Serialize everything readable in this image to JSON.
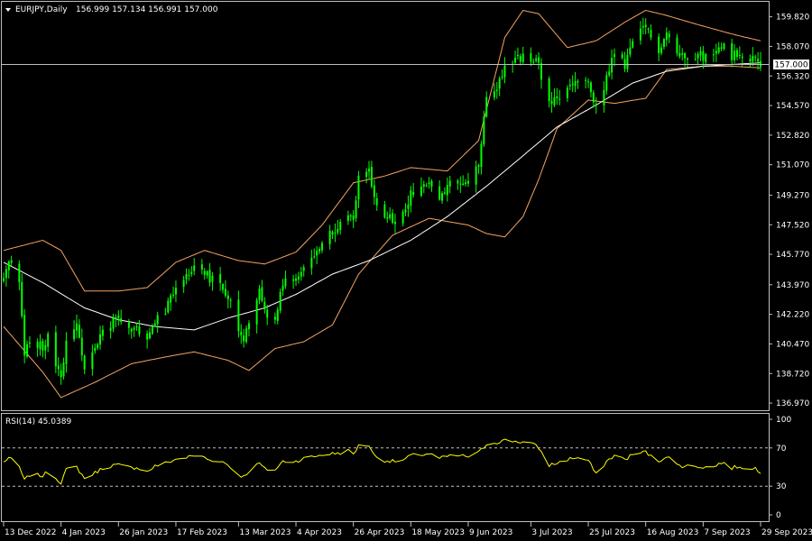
{
  "header": {
    "symbol_label": "EURJPY,Daily",
    "ohlc_label": "156.999 157.134 156.991 157.000",
    "rsi_label": "RSI(14) 45.0389"
  },
  "current_price_label": "157.000",
  "colors": {
    "background": "#000000",
    "bull_candle": "#00ff00",
    "bear_candle": "#00ff00",
    "bollinger": "#f4a460",
    "moving_average": "#ffffff",
    "rsi_line": "#ffff00",
    "frame": "#c0c0c0",
    "price_line": "#c0c0c0",
    "level_lines": "#c0c0c0"
  },
  "chart_data": [
    {
      "type": "candlestick",
      "title": "EURJPY,Daily",
      "price_ticks": [
        "159.820",
        "158.070",
        "156.320",
        "154.570",
        "152.820",
        "151.070",
        "149.270",
        "147.520",
        "145.770",
        "143.970",
        "142.220",
        "140.470",
        "138.720",
        "136.970"
      ],
      "ylim": [
        136.6,
        160.6
      ],
      "date_ticks": [
        "13 Dec 2022",
        "4 Jan 2023",
        "26 Jan 2023",
        "17 Feb 2023",
        "13 Mar 2023",
        "4 Apr 2023",
        "26 Apr 2023",
        "18 May 2023",
        "9 Jun 2023",
        "3 Jul 2023",
        "25 Jul 2023",
        "16 Aug 2023",
        "7 Sep 2023",
        "29 Sep 2023"
      ],
      "current_price": 157.0,
      "close_path": [
        [
          "13 Dec 2022",
          144.2
        ],
        [
          "15 Dec 2022",
          145.6
        ],
        [
          "19 Dec 2022",
          144.0
        ],
        [
          "21 Dec 2022",
          139.8
        ],
        [
          "23 Dec 2022",
          140.8
        ],
        [
          "28 Dec 2022",
          140.3
        ],
        [
          "30 Dec 2022",
          140.8
        ],
        [
          "4 Jan 2023",
          138.2
        ],
        [
          "6 Jan 2023",
          140.9
        ],
        [
          "10 Jan 2023",
          141.5
        ],
        [
          "13 Jan 2023",
          138.9
        ],
        [
          "17 Jan 2023",
          140.0
        ],
        [
          "20 Jan 2023",
          141.2
        ],
        [
          "24 Jan 2023",
          141.8
        ],
        [
          "26 Jan 2023",
          141.9
        ],
        [
          "31 Jan 2023",
          141.2
        ],
        [
          "2 Feb 2023",
          141.5
        ],
        [
          "6 Feb 2023",
          140.6
        ],
        [
          "9 Feb 2023",
          141.8
        ],
        [
          "13 Feb 2023",
          142.4
        ],
        [
          "15 Feb 2023",
          143.2
        ],
        [
          "17 Feb 2023",
          143.8
        ],
        [
          "21 Feb 2023",
          144.5
        ],
        [
          "24 Feb 2023",
          145.1
        ],
        [
          "28 Feb 2023",
          144.8
        ],
        [
          "2 Mar 2023",
          144.3
        ],
        [
          "6 Mar 2023",
          144.2
        ],
        [
          "9 Mar 2023",
          143.3
        ],
        [
          "13 Mar 2023",
          141.4
        ],
        [
          "15 Mar 2023",
          140.9
        ],
        [
          "17 Mar 2023",
          141.9
        ],
        [
          "21 Mar 2023",
          143.6
        ],
        [
          "23 Mar 2023",
          142.3
        ],
        [
          "27 Mar 2023",
          142.1
        ],
        [
          "30 Mar 2023",
          144.2
        ],
        [
          "4 Apr 2023",
          144.3
        ],
        [
          "7 Apr 2023",
          145.3
        ],
        [
          "11 Apr 2023",
          145.9
        ],
        [
          "14 Apr 2023",
          146.6
        ],
        [
          "18 Apr 2023",
          147.0
        ],
        [
          "21 Apr 2023",
          147.5
        ],
        [
          "24 Apr 2023",
          148.3
        ],
        [
          "26 Apr 2023",
          147.9
        ],
        [
          "28 Apr 2023",
          150.2
        ],
        [
          "2 May 2023",
          150.8
        ],
        [
          "4 May 2023",
          149.0
        ],
        [
          "8 May 2023",
          148.0
        ],
        [
          "11 May 2023",
          147.8
        ],
        [
          "15 May 2023",
          148.0
        ],
        [
          "18 May 2023",
          149.3
        ],
        [
          "22 May 2023",
          149.7
        ],
        [
          "25 May 2023",
          149.8
        ],
        [
          "29 May 2023",
          149.1
        ],
        [
          "1 Jun 2023",
          149.8
        ],
        [
          "5 Jun 2023",
          150.0
        ],
        [
          "9 Jun 2023",
          149.9
        ],
        [
          "13 Jun 2023",
          151.0
        ],
        [
          "16 Jun 2023",
          155.0
        ],
        [
          "20 Jun 2023",
          155.7
        ],
        [
          "23 Jun 2023",
          156.9
        ],
        [
          "27 Jun 2023",
          157.3
        ],
        [
          "30 Jun 2023",
          157.4
        ],
        [
          "3 Jul 2023",
          157.3
        ],
        [
          "6 Jul 2023",
          157.0
        ],
        [
          "10 Jul 2023",
          154.6
        ],
        [
          "13 Jul 2023",
          154.9
        ],
        [
          "17 Jul 2023",
          155.5
        ],
        [
          "20 Jul 2023",
          156.0
        ],
        [
          "25 Jul 2023",
          155.8
        ],
        [
          "28 Jul 2023",
          154.3
        ],
        [
          "1 Aug 2023",
          156.2
        ],
        [
          "4 Aug 2023",
          157.6
        ],
        [
          "8 Aug 2023",
          157.0
        ],
        [
          "11 Aug 2023",
          158.3
        ],
        [
          "16 Aug 2023",
          159.2
        ],
        [
          "18 Aug 2023",
          158.6
        ],
        [
          "21 Aug 2023",
          157.9
        ],
        [
          "24 Aug 2023",
          158.9
        ],
        [
          "28 Aug 2023",
          157.6
        ],
        [
          "31 Aug 2023",
          157.6
        ],
        [
          "4 Sep 2023",
          157.6
        ],
        [
          "7 Sep 2023",
          157.5
        ],
        [
          "11 Sep 2023",
          157.4
        ],
        [
          "14 Sep 2023",
          158.3
        ],
        [
          "18 Sep 2023",
          157.5
        ],
        [
          "21 Sep 2023",
          157.8
        ],
        [
          "25 Sep 2023",
          157.2
        ],
        [
          "27 Sep 2023",
          157.4
        ],
        [
          "29 Sep 2023",
          157.0
        ]
      ],
      "bollinger_upper": [
        [
          "13 Dec 2022",
          146.0
        ],
        [
          "28 Dec 2022",
          146.6
        ],
        [
          "4 Jan 2023",
          146.0
        ],
        [
          "13 Jan 2023",
          143.6
        ],
        [
          "26 Jan 2023",
          143.6
        ],
        [
          "6 Feb 2023",
          143.8
        ],
        [
          "17 Feb 2023",
          145.3
        ],
        [
          "28 Feb 2023",
          146.0
        ],
        [
          "13 Mar 2023",
          145.4
        ],
        [
          "23 Mar 2023",
          145.2
        ],
        [
          "4 Apr 2023",
          145.9
        ],
        [
          "14 Apr 2023",
          147.5
        ],
        [
          "26 Apr 2023",
          150.0
        ],
        [
          "8 May 2023",
          150.4
        ],
        [
          "18 May 2023",
          150.9
        ],
        [
          "1 Jun 2023",
          150.7
        ],
        [
          "13 Jun 2023",
          152.5
        ],
        [
          "23 Jun 2023",
          158.6
        ],
        [
          "30 Jun 2023",
          160.2
        ],
        [
          "6 Jul 2023",
          160.0
        ],
        [
          "17 Jul 2023",
          158.0
        ],
        [
          "28 Jul 2023",
          158.4
        ],
        [
          "8 Aug 2023",
          159.5
        ],
        [
          "16 Aug 2023",
          160.2
        ],
        [
          "24 Aug 2023",
          159.9
        ],
        [
          "4 Sep 2023",
          159.4
        ],
        [
          "18 Sep 2023",
          158.8
        ],
        [
          "29 Sep 2023",
          158.4
        ]
      ],
      "bollinger_lower": [
        [
          "13 Dec 2022",
          141.5
        ],
        [
          "28 Dec 2022",
          138.8
        ],
        [
          "4 Jan 2023",
          137.3
        ],
        [
          "17 Jan 2023",
          138.2
        ],
        [
          "31 Jan 2023",
          139.3
        ],
        [
          "13 Feb 2023",
          139.7
        ],
        [
          "24 Feb 2023",
          140.0
        ],
        [
          "9 Mar 2023",
          139.5
        ],
        [
          "17 Mar 2023",
          138.9
        ],
        [
          "27 Mar 2023",
          140.2
        ],
        [
          "7 Apr 2023",
          140.6
        ],
        [
          "18 Apr 2023",
          141.6
        ],
        [
          "28 Apr 2023",
          144.6
        ],
        [
          "11 May 2023",
          146.9
        ],
        [
          "25 May 2023",
          147.9
        ],
        [
          "9 Jun 2023",
          147.5
        ],
        [
          "16 Jun 2023",
          147.0
        ],
        [
          "23 Jun 2023",
          146.8
        ],
        [
          "30 Jun 2023",
          148.0
        ],
        [
          "6 Jul 2023",
          150.2
        ],
        [
          "13 Jul 2023",
          153.2
        ],
        [
          "25 Jul 2023",
          154.9
        ],
        [
          "4 Aug 2023",
          154.7
        ],
        [
          "16 Aug 2023",
          155.0
        ],
        [
          "24 Aug 2023",
          156.7
        ],
        [
          "7 Sep 2023",
          156.9
        ],
        [
          "18 Sep 2023",
          156.9
        ],
        [
          "29 Sep 2023",
          156.8
        ]
      ],
      "moving_average": [
        [
          "13 Dec 2022",
          145.3
        ],
        [
          "28 Dec 2022",
          144.1
        ],
        [
          "13 Jan 2023",
          142.6
        ],
        [
          "26 Jan 2023",
          141.9
        ],
        [
          "9 Feb 2023",
          141.5
        ],
        [
          "24 Feb 2023",
          141.3
        ],
        [
          "9 Mar 2023",
          142.0
        ],
        [
          "23 Mar 2023",
          142.6
        ],
        [
          "4 Apr 2023",
          143.4
        ],
        [
          "18 Apr 2023",
          144.6
        ],
        [
          "2 May 2023",
          145.4
        ],
        [
          "18 May 2023",
          146.6
        ],
        [
          "1 Jun 2023",
          148.0
        ],
        [
          "16 Jun 2023",
          149.8
        ],
        [
          "30 Jun 2023",
          151.6
        ],
        [
          "13 Jul 2023",
          153.3
        ],
        [
          "28 Jul 2023",
          154.6
        ],
        [
          "11 Aug 2023",
          155.9
        ],
        [
          "24 Aug 2023",
          156.6
        ],
        [
          "7 Sep 2023",
          156.9
        ],
        [
          "29 Sep 2023",
          157.1
        ]
      ]
    },
    {
      "type": "line",
      "title": "RSI(14) 45.0389",
      "y_ticks": [
        "100",
        "70",
        "30",
        "0"
      ],
      "ylim": [
        0,
        100
      ],
      "levels": [
        30,
        70
      ],
      "series": [
        {
          "values": [
            [
              "13 Dec 2022",
              55
            ],
            [
              "15 Dec 2022",
              60
            ],
            [
              "19 Dec 2022",
              50
            ],
            [
              "21 Dec 2022",
              36
            ],
            [
              "23 Dec 2022",
              42
            ],
            [
              "28 Dec 2022",
              41
            ],
            [
              "30 Dec 2022",
              45
            ],
            [
              "4 Jan 2023",
              34
            ],
            [
              "6 Jan 2023",
              47
            ],
            [
              "10 Jan 2023",
              50
            ],
            [
              "13 Jan 2023",
              38
            ],
            [
              "17 Jan 2023",
              44
            ],
            [
              "20 Jan 2023",
              49
            ],
            [
              "24 Jan 2023",
              52
            ],
            [
              "26 Jan 2023",
              52
            ],
            [
              "31 Jan 2023",
              49
            ],
            [
              "2 Feb 2023",
              50
            ],
            [
              "6 Feb 2023",
              45
            ],
            [
              "9 Feb 2023",
              51
            ],
            [
              "13 Feb 2023",
              54
            ],
            [
              "15 Feb 2023",
              56
            ],
            [
              "17 Feb 2023",
              58
            ],
            [
              "21 Feb 2023",
              60
            ],
            [
              "24 Feb 2023",
              62
            ],
            [
              "28 Feb 2023",
              60
            ],
            [
              "2 Mar 2023",
              57
            ],
            [
              "6 Mar 2023",
              57
            ],
            [
              "9 Mar 2023",
              52
            ],
            [
              "13 Mar 2023",
              42
            ],
            [
              "15 Mar 2023",
              40
            ],
            [
              "17 Mar 2023",
              46
            ],
            [
              "21 Mar 2023",
              54
            ],
            [
              "23 Mar 2023",
              48
            ],
            [
              "27 Mar 2023",
              47
            ],
            [
              "30 Mar 2023",
              56
            ],
            [
              "4 Apr 2023",
              56
            ],
            [
              "7 Apr 2023",
              59
            ],
            [
              "11 Apr 2023",
              61
            ],
            [
              "14 Apr 2023",
              63
            ],
            [
              "18 Apr 2023",
              64
            ],
            [
              "21 Apr 2023",
              65
            ],
            [
              "24 Apr 2023",
              67
            ],
            [
              "26 Apr 2023",
              64
            ],
            [
              "28 Apr 2023",
              72
            ],
            [
              "2 May 2023",
              73
            ],
            [
              "4 May 2023",
              62
            ],
            [
              "8 May 2023",
              57
            ],
            [
              "11 May 2023",
              56
            ],
            [
              "15 May 2023",
              57
            ],
            [
              "18 May 2023",
              62
            ],
            [
              "22 May 2023",
              63
            ],
            [
              "25 May 2023",
              64
            ],
            [
              "29 May 2023",
              59
            ],
            [
              "1 Jun 2023",
              61
            ],
            [
              "5 Jun 2023",
              62
            ],
            [
              "9 Jun 2023",
              61
            ],
            [
              "13 Jun 2023",
              65
            ],
            [
              "16 Jun 2023",
              74
            ],
            [
              "20 Jun 2023",
              76
            ],
            [
              "23 Jun 2023",
              78
            ],
            [
              "27 Jun 2023",
              77
            ],
            [
              "30 Jun 2023",
              76
            ],
            [
              "3 Jul 2023",
              75
            ],
            [
              "6 Jul 2023",
              70
            ],
            [
              "10 Jul 2023",
              52
            ],
            [
              "13 Jul 2023",
              54
            ],
            [
              "17 Jul 2023",
              58
            ],
            [
              "20 Jul 2023",
              60
            ],
            [
              "25 Jul 2023",
              57
            ],
            [
              "28 Jul 2023",
              42
            ],
            [
              "1 Aug 2023",
              56
            ],
            [
              "4 Aug 2023",
              62
            ],
            [
              "8 Aug 2023",
              58
            ],
            [
              "11 Aug 2023",
              63
            ],
            [
              "16 Aug 2023",
              66
            ],
            [
              "18 Aug 2023",
              61
            ],
            [
              "21 Aug 2023",
              56
            ],
            [
              "24 Aug 2023",
              62
            ],
            [
              "28 Aug 2023",
              52
            ],
            [
              "31 Aug 2023",
              51
            ],
            [
              "4 Sep 2023",
              51
            ],
            [
              "7 Sep 2023",
              50
            ],
            [
              "11 Sep 2023",
              50
            ],
            [
              "14 Sep 2023",
              55
            ],
            [
              "18 Sep 2023",
              49
            ],
            [
              "21 Sep 2023",
              51
            ],
            [
              "25 Sep 2023",
              47
            ],
            [
              "27 Sep 2023",
              49
            ],
            [
              "29 Sep 2023",
              45
            ]
          ]
        }
      ]
    }
  ]
}
